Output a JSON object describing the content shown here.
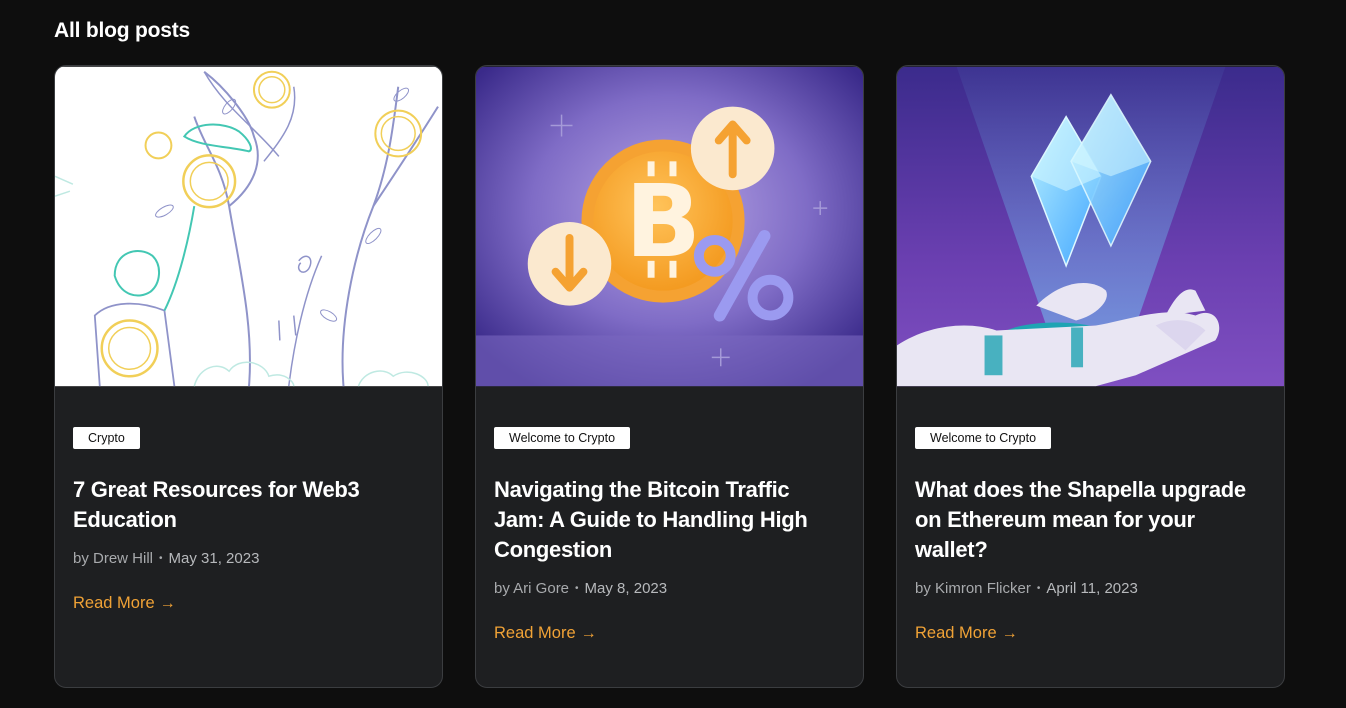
{
  "section": {
    "title": "All blog posts"
  },
  "posts": [
    {
      "tag": "Crypto",
      "title": "7 Great Resources for Web3 Education",
      "author": "by Drew Hill",
      "date": "May 31, 2023",
      "read_more": "Read More",
      "image": "illustration-person-tree-coins"
    },
    {
      "tag": "Welcome to Crypto",
      "title": "Navigating the Bitcoin Traffic Jam: A Guide to Handling High Congestion",
      "author": "by Ari Gore",
      "date": "May 8, 2023",
      "read_more": "Read More",
      "image": "bitcoin-coin-with-arrows-and-percent"
    },
    {
      "tag": "Welcome to Crypto",
      "title": "What does the Shapella upgrade on Ethereum mean for your wallet?",
      "author": "by Kimron Flicker",
      "date": "April 11, 2023",
      "read_more": "Read More",
      "image": "robot-hand-holding-ethereum-crystal"
    }
  ],
  "colors": {
    "background": "#0e0e0e",
    "card": "#1e1f21",
    "accent": "#f0a236",
    "tag_bg": "#ffffff"
  },
  "icons": {
    "read_more_arrow": "arrow-right-icon",
    "meta_separator": "dot-icon"
  }
}
